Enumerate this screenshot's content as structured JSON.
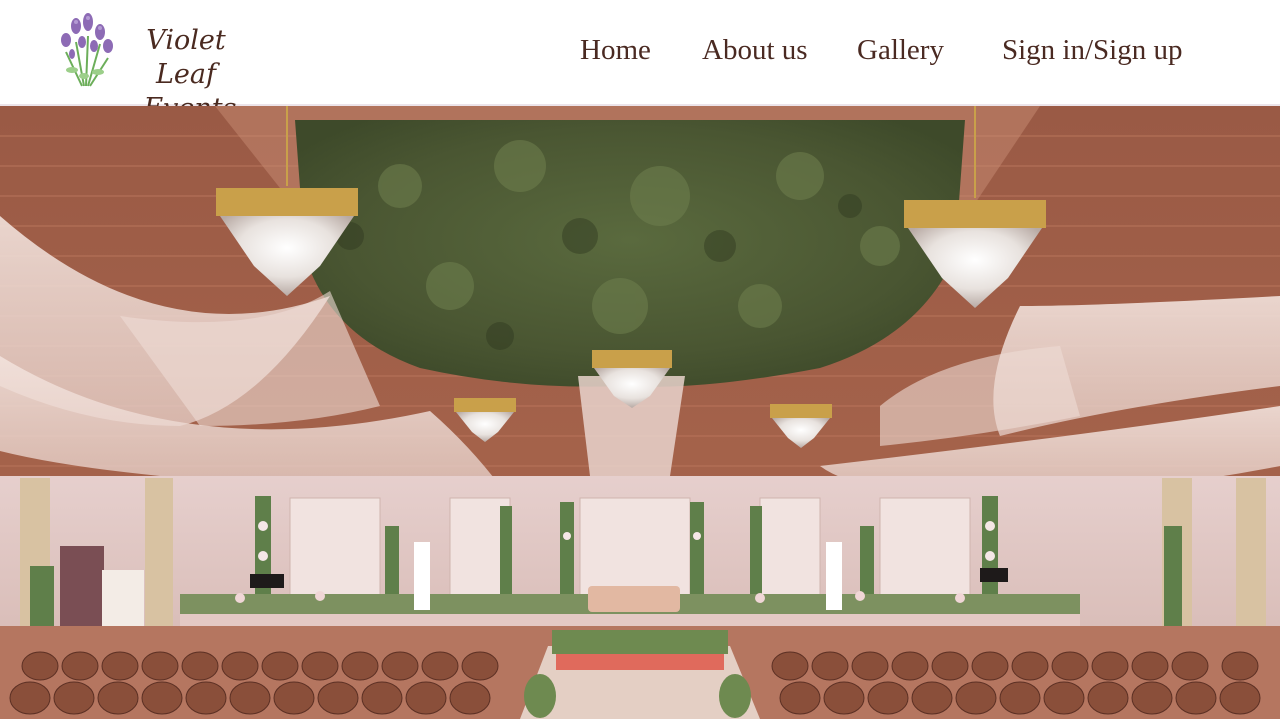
{
  "brand": {
    "line1": "Violet Leaf",
    "line2": "Events",
    "logo_icon": "lavender-bouquet-icon",
    "colors": {
      "lavender": "#8d6bb5",
      "leaf": "#6cae5a",
      "text": "#4a2a20"
    }
  },
  "nav": {
    "home": "Home",
    "about": "About us",
    "gallery": "Gallery",
    "signin": "Sign in/Sign up"
  },
  "hero": {
    "image": "wedding-hall-photo",
    "description": "Decorated banquet hall with floral ceiling, crystal chandeliers, draped fabric, stage and rows of chairs"
  }
}
